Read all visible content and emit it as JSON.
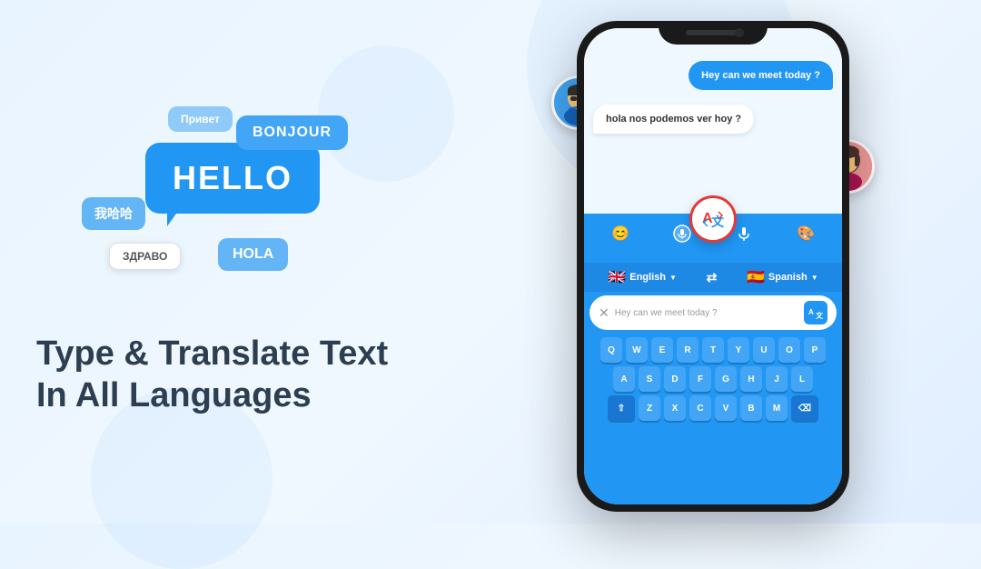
{
  "app": {
    "title": "Type & Translate Text In All Languages"
  },
  "bubbles": {
    "hello": "HELLO",
    "bonjour": "BONJOUR",
    "hola": "HOLA",
    "privet": "Привет",
    "zdravo": "ЗДРАВО",
    "chinese": "我哈哈"
  },
  "heading": {
    "line1": "Type & Translate Text",
    "line2": "In All Languages"
  },
  "chat": {
    "msg1": "Hey can we meet today ?",
    "msg2": "hola nos podemos ver hoy ?"
  },
  "toolbar": {
    "emoji_icon": "😊",
    "mic_keyboard_icon": "🎤",
    "translate_icon": "🔁",
    "mic_icon": "🎤",
    "palette_icon": "🎨"
  },
  "languages": {
    "source": "English",
    "source_flag": "🇬🇧",
    "target": "Spanish",
    "target_flag": "🇪🇸"
  },
  "input": {
    "placeholder": "Hey can we meet today ?",
    "translate_label": "翻A"
  },
  "keyboard": {
    "rows": [
      [
        "Q",
        "W",
        "E",
        "R",
        "T",
        "Y",
        "U",
        "O",
        "P"
      ],
      [
        "A",
        "S",
        "D",
        "F",
        "G",
        "H",
        "J",
        "L"
      ],
      [
        "⇧",
        "Z",
        "X",
        "C",
        "V",
        "B",
        "M",
        "⌫"
      ]
    ]
  }
}
